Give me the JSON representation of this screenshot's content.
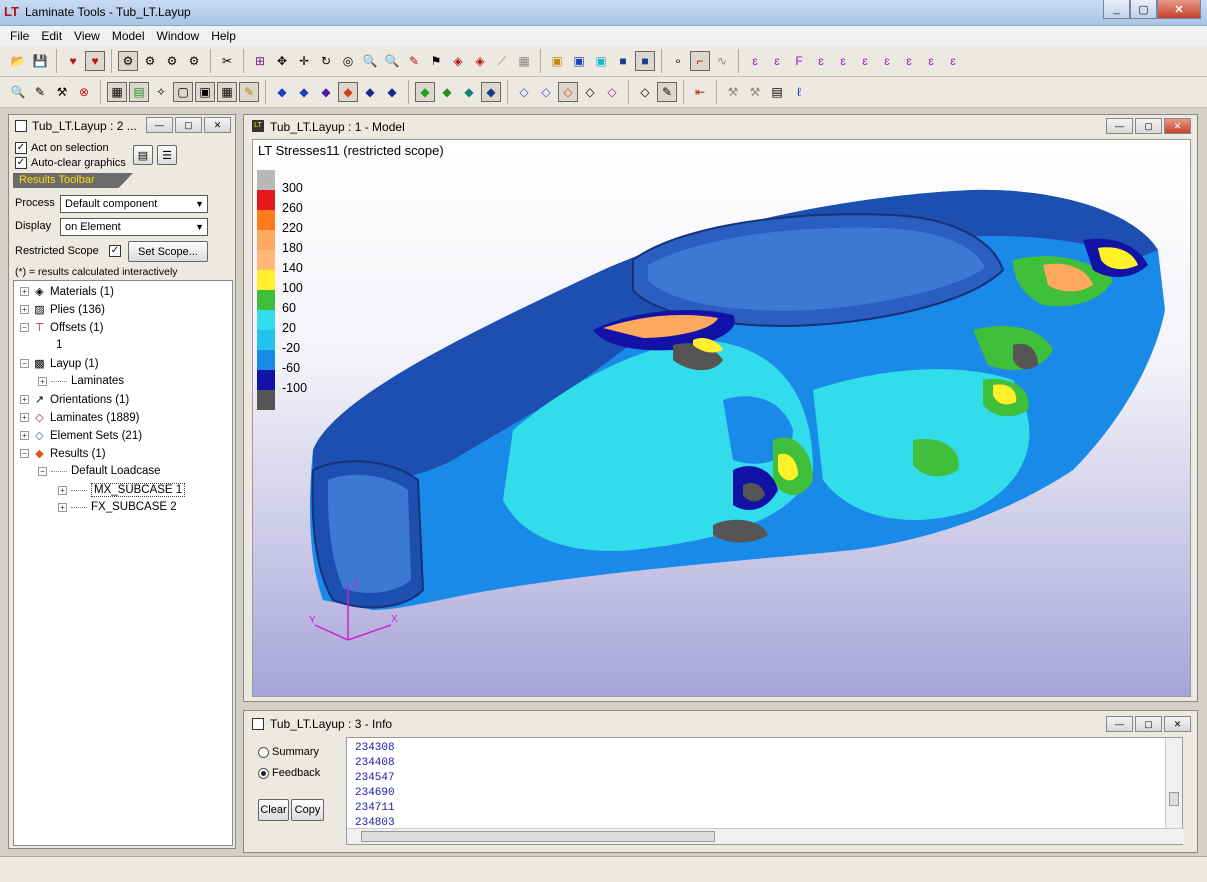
{
  "window": {
    "title": "Laminate Tools - Tub_LT.Layup",
    "app_icon_text": "LT"
  },
  "menu": [
    "File",
    "Edit",
    "View",
    "Model",
    "Window",
    "Help"
  ],
  "left_panel": {
    "title": "Tub_LT.Layup : 2 ...",
    "act_on_selection": "Act on selection",
    "auto_clear_graphics": "Auto-clear graphics",
    "results_toolbar": "Results Toolbar",
    "process_label": "Process",
    "process_value": "Default component",
    "display_label": "Display",
    "display_value": "on Element",
    "restricted_scope_label": "Restricted Scope",
    "set_scope_button": "Set Scope...",
    "note": "(*) = results calculated interactively",
    "tree": [
      {
        "label": "Materials (1)",
        "icon": "material-icon"
      },
      {
        "label": "Plies (136)",
        "icon": "plies-icon"
      },
      {
        "label": "Offsets (1)",
        "icon": "offset-icon"
      },
      {
        "label": "1",
        "icon": ""
      },
      {
        "label": "Layup (1)",
        "icon": "layup-icon"
      },
      {
        "label": "Laminates",
        "icon": ""
      },
      {
        "label": "Orientations (1)",
        "icon": "orientation-arrow-icon"
      },
      {
        "label": "Laminates (1889)",
        "icon": "laminate-icon"
      },
      {
        "label": "Element Sets (21)",
        "icon": "element-set-icon"
      },
      {
        "label": "Results (1)",
        "icon": "results-icon"
      },
      {
        "label": "Default Loadcase",
        "icon": ""
      },
      {
        "label": "MX_SUBCASE 1",
        "icon": ""
      },
      {
        "label": "FX_SUBCASE 2",
        "icon": ""
      }
    ]
  },
  "model_window": {
    "title": "Tub_LT.Layup : 1 - Model",
    "caption": "LT Stresses11  (restricted scope)",
    "legend": [
      {
        "label": "300",
        "color": "#b8b8b8"
      },
      {
        "label": "260",
        "color": "#e8171b"
      },
      {
        "label": "220",
        "color": "#ff7a1a"
      },
      {
        "label": "180",
        "color": "#ffa860"
      },
      {
        "label": "140",
        "color": "#ffb878"
      },
      {
        "label": "100",
        "color": "#fff02a"
      },
      {
        "label": "60",
        "color": "#3fbf3a"
      },
      {
        "label": "20",
        "color": "#32dcea"
      },
      {
        "label": "-20",
        "color": "#20c2ee"
      },
      {
        "label": "-60",
        "color": "#1a8ae8"
      },
      {
        "label": "-100",
        "color": "#1212a6"
      },
      {
        "label": "",
        "color": "#555555"
      }
    ],
    "axis_x": "X",
    "axis_y": "Y",
    "axis_z": "Z"
  },
  "info_window": {
    "title": "Tub_LT.Layup : 3 - Info",
    "summary_label": "Summary",
    "feedback_label": "Feedback",
    "clear_button": "Clear",
    "copy_button": "Copy",
    "lines": [
      "234308",
      "234408",
      "234547",
      "234690",
      "234711",
      "234803"
    ]
  }
}
